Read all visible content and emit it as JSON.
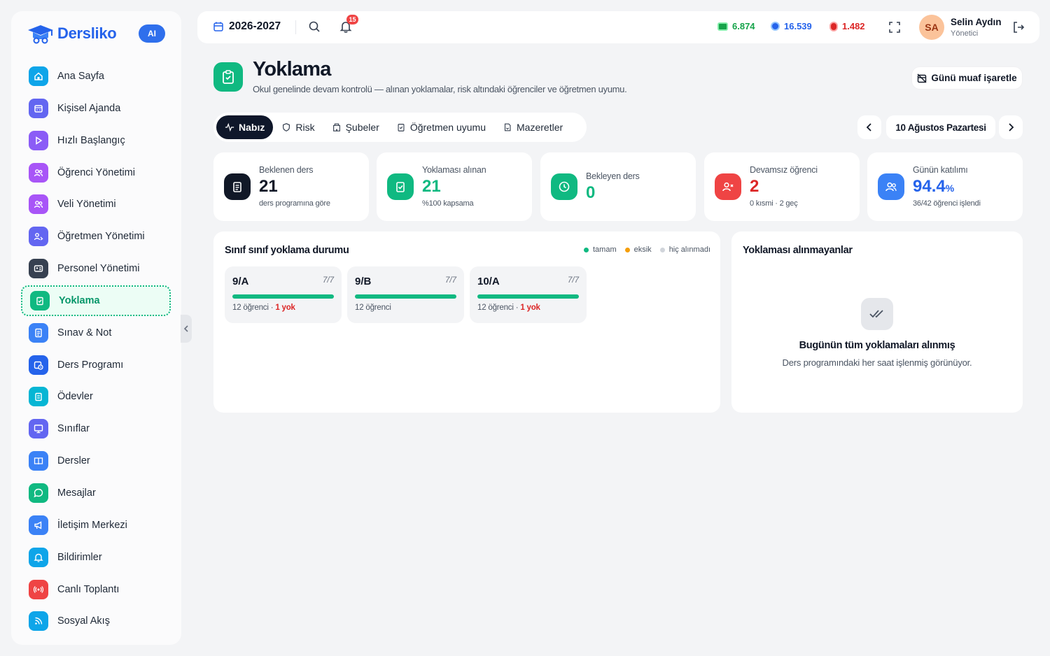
{
  "app": {
    "name": "Dersliko",
    "ai_badge": "AI"
  },
  "sidebar": {
    "items": [
      {
        "label": "Ana Sayfa",
        "icon": "home-icon",
        "color": "#0ea5e9"
      },
      {
        "label": "Kişisel Ajanda",
        "icon": "calendar-icon",
        "color": "#6366f1"
      },
      {
        "label": "Hızlı Başlangıç",
        "icon": "play-icon",
        "color": "#8b5cf6"
      },
      {
        "label": "Öğrenci Yönetimi",
        "icon": "users-icon",
        "color": "#a855f7"
      },
      {
        "label": "Veli Yönetimi",
        "icon": "users-icon",
        "color": "#a855f7"
      },
      {
        "label": "Öğretmen Yönetimi",
        "icon": "teacher-icon",
        "color": "#6366f1"
      },
      {
        "label": "Personel Yönetimi",
        "icon": "id-card-icon",
        "color": "#374151"
      },
      {
        "label": "Yoklama",
        "icon": "clipboard-check-icon",
        "color": "#10b981",
        "active": true
      },
      {
        "label": "Sınav & Not",
        "icon": "exam-icon",
        "color": "#3b82f6"
      },
      {
        "label": "Ders Programı",
        "icon": "calendar-clock-icon",
        "color": "#2563eb"
      },
      {
        "label": "Ödevler",
        "icon": "clipboard-icon",
        "color": "#06b6d4"
      },
      {
        "label": "Sınıflar",
        "icon": "monitor-icon",
        "color": "#6366f1"
      },
      {
        "label": "Dersler",
        "icon": "book-icon",
        "color": "#3b82f6"
      },
      {
        "label": "Mesajlar",
        "icon": "message-icon",
        "color": "#10b981"
      },
      {
        "label": "İletişim Merkezi",
        "icon": "megaphone-icon",
        "color": "#3b82f6"
      },
      {
        "label": "Bildirimler",
        "icon": "bell-icon",
        "color": "#0ea5e9"
      },
      {
        "label": "Canlı Toplantı",
        "icon": "broadcast-icon",
        "color": "#ef4444"
      },
      {
        "label": "Sosyal Akış",
        "icon": "rss-icon",
        "color": "#0ea5e9"
      }
    ]
  },
  "topbar": {
    "year": "2026-2027",
    "notification_count": "15",
    "stats": [
      {
        "value": "6.874",
        "color": "#16a34a",
        "icon": "money-icon"
      },
      {
        "value": "16.539",
        "color": "#2563eb",
        "icon": "gem-icon"
      },
      {
        "value": "1.482",
        "color": "#dc2626",
        "icon": "fire-icon"
      }
    ],
    "user": {
      "initials": "SA",
      "name": "Selin Aydın",
      "role": "Yönetici"
    }
  },
  "page": {
    "title": "Yoklama",
    "subtitle": "Okul genelinde devam kontrolü — alınan yoklamalar, risk altındaki öğrenciler ve öğretmen uyumu.",
    "exempt_button": "Günü muaf işaretle"
  },
  "tabs": [
    {
      "label": "Nabız",
      "icon": "pulse-icon",
      "active": true
    },
    {
      "label": "Risk",
      "icon": "shield-icon"
    },
    {
      "label": "Şubeler",
      "icon": "building-icon"
    },
    {
      "label": "Öğretmen uyumu",
      "icon": "clipboard-icon"
    },
    {
      "label": "Mazeretler",
      "icon": "document-icon"
    }
  ],
  "date": {
    "label": "10 Ağustos Pazartesi"
  },
  "kpis": [
    {
      "label": "Beklenen ders",
      "value": "21",
      "note": "ders programına göre",
      "color": "#111827",
      "icon_bg": "#111827"
    },
    {
      "label": "Yoklaması alınan",
      "value": "21",
      "note": "%100 kapsama",
      "color": "#10b981",
      "icon_bg": "#10b981"
    },
    {
      "label": "Bekleyen ders",
      "value": "0",
      "note": "",
      "color": "#10b981",
      "icon_bg": "#10b981"
    },
    {
      "label": "Devamsız öğrenci",
      "value": "2",
      "note": "0 kısmi · 2 geç",
      "color": "#dc2626",
      "icon_bg": "#ef4444"
    },
    {
      "label": "Günün katılımı",
      "value": "94.4",
      "unit": "%",
      "note": "36/42 öğrenci işlendi",
      "color": "#2563eb",
      "icon_bg": "#3b82f6"
    }
  ],
  "class_panel": {
    "title": "Sınıf sınıf yoklama durumu",
    "legend": [
      {
        "label": "tamam",
        "color": "#10b981"
      },
      {
        "label": "eksik",
        "color": "#f59e0b"
      },
      {
        "label": "hiç alınmadı",
        "color": "#d1d5db"
      }
    ],
    "classes": [
      {
        "name": "9/A",
        "ratio": "7/7",
        "students": "12 öğrenci",
        "absent": "1 yok",
        "progress": 1.0
      },
      {
        "name": "9/B",
        "ratio": "7/7",
        "students": "12 öğrenci",
        "absent": "",
        "progress": 1.0
      },
      {
        "name": "10/A",
        "ratio": "7/7",
        "students": "12 öğrenci",
        "absent": "1 yok",
        "progress": 1.0
      }
    ]
  },
  "missing_panel": {
    "title": "Yoklaması alınmayanlar",
    "empty_title": "Bugünün tüm yoklamaları alınmış",
    "empty_sub": "Ders programındaki her saat işlenmiş görünüyor."
  }
}
